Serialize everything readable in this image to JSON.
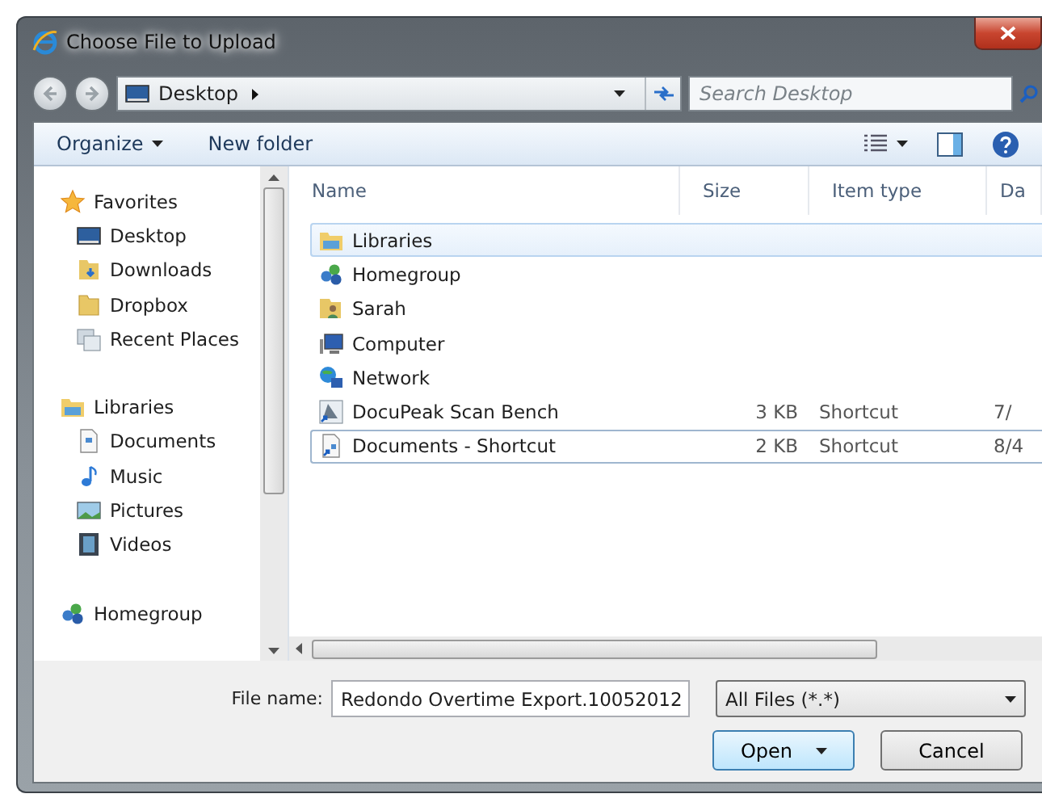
{
  "window": {
    "title": "Choose File to Upload"
  },
  "address": {
    "location": "Desktop",
    "search_placeholder": "Search Desktop"
  },
  "toolbar": {
    "organize": "Organize",
    "new_folder": "New folder"
  },
  "navigation": [
    {
      "label": "Favorites",
      "kind": "star",
      "children": [
        {
          "label": "Desktop",
          "kind": "desktop"
        },
        {
          "label": "Downloads",
          "kind": "downloads"
        },
        {
          "label": "Dropbox",
          "kind": "folder"
        },
        {
          "label": "Recent Places",
          "kind": "recent"
        }
      ]
    },
    {
      "label": "Libraries",
      "kind": "library",
      "children": [
        {
          "label": "Documents",
          "kind": "document"
        },
        {
          "label": "Music",
          "kind": "music"
        },
        {
          "label": "Pictures",
          "kind": "pictures"
        },
        {
          "label": "Videos",
          "kind": "videos"
        }
      ]
    },
    {
      "label": "Homegroup",
      "kind": "homegroup"
    }
  ],
  "table": {
    "columns": [
      "Name",
      "Size",
      "Item type",
      "Da"
    ],
    "rows": [
      {
        "name": "Libraries",
        "kind": "library",
        "size": "",
        "type": "",
        "date": "",
        "selected": true,
        "focused": false
      },
      {
        "name": "Homegroup",
        "kind": "homegroup",
        "size": "",
        "type": "",
        "date": "",
        "selected": false,
        "focused": false
      },
      {
        "name": "Sarah",
        "kind": "user",
        "size": "",
        "type": "",
        "date": "",
        "selected": false,
        "focused": false
      },
      {
        "name": "Computer",
        "kind": "computer",
        "size": "",
        "type": "",
        "date": "",
        "selected": false,
        "focused": false
      },
      {
        "name": "Network",
        "kind": "network",
        "size": "",
        "type": "",
        "date": "",
        "selected": false,
        "focused": false
      },
      {
        "name": "DocuPeak Scan Bench",
        "kind": "shortcut",
        "size": "3 KB",
        "type": "Shortcut",
        "date": "7/",
        "selected": false,
        "focused": false
      },
      {
        "name": "Documents - Shortcut",
        "kind": "doc-shortcut",
        "size": "2 KB",
        "type": "Shortcut",
        "date": "8/4",
        "selected": false,
        "focused": true
      }
    ]
  },
  "file_name": {
    "label": "File name:",
    "value": "Redondo Overtime Export.10052012"
  },
  "file_type": "All Files (*.*)",
  "buttons": {
    "open": "Open",
    "cancel": "Cancel"
  }
}
